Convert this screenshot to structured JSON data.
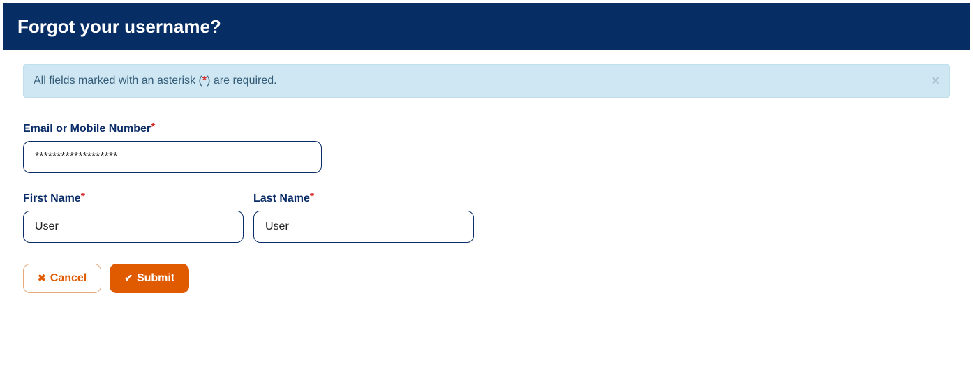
{
  "header": {
    "title": "Forgot your username?"
  },
  "alert": {
    "text_before": "All fields marked with an asterisk (",
    "asterisk": "*",
    "text_after": ") are required."
  },
  "form": {
    "email": {
      "label": "Email or Mobile Number",
      "value": "*******************"
    },
    "first_name": {
      "label": "First Name",
      "value": "User"
    },
    "last_name": {
      "label": "Last Name",
      "value": "User"
    }
  },
  "buttons": {
    "cancel": "Cancel",
    "submit": "Submit"
  },
  "required_marker": "*"
}
